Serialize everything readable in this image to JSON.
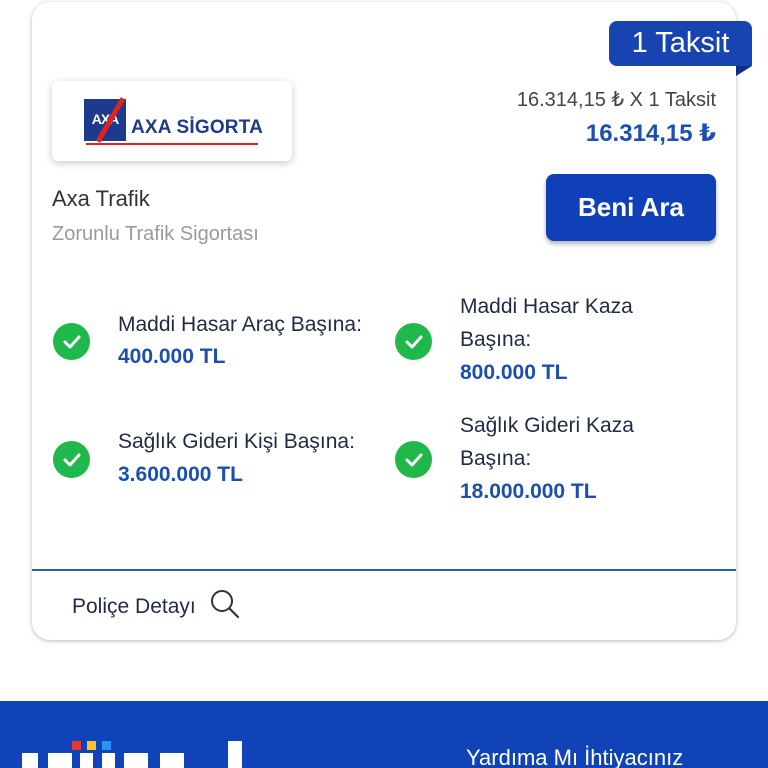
{
  "offer": {
    "installment_badge": "1 Taksit",
    "insurer_logo_text": "AXA SİGORTA",
    "price_per_installment": "16.314,15 ₺ X 1 Taksit",
    "total_price": "16.314,15 ₺",
    "product_name": "Axa Trafik",
    "product_type": "Zorunlu Trafik Sigortası",
    "cta_label": "Beni Ara",
    "coverages": [
      {
        "label_line1": "Maddi Hasar Araç Başına:",
        "label_line2": "",
        "value": "400.000 TL"
      },
      {
        "label_line1": "Maddi Hasar Kaza",
        "label_line2": "Başına:",
        "value": "800.000 TL"
      },
      {
        "label_line1": "Sağlık Gideri Kişi Başına:",
        "label_line2": "",
        "value": "3.600.000 TL"
      },
      {
        "label_line1": "Sağlık Gideri Kaza",
        "label_line2": "Başına:",
        "value": "18.000.000 TL"
      }
    ],
    "policy_detail_label": "Poliçe Detayı"
  },
  "footer": {
    "help_text": "Yardıma Mı İhtiyacınız"
  },
  "colors": {
    "brand_blue": "#1043b8",
    "accent_value_blue": "#1d4fb0",
    "check_green": "#1fb84a"
  },
  "icons": {
    "check": "check-circle-icon",
    "search": "search-icon"
  }
}
